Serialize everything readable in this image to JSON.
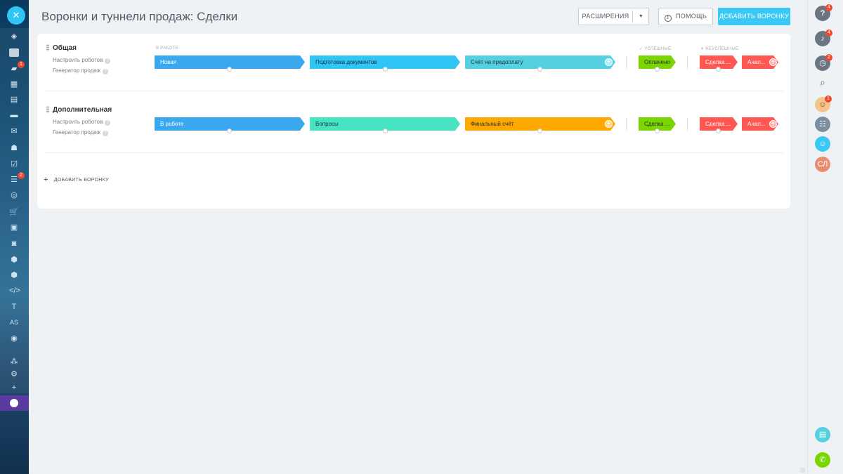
{
  "page": {
    "title": "Воронки и туннели продаж: Сделки",
    "buttons": {
      "extensions": "РАСШИРЕНИЯ",
      "help": "ПОМОЩЬ",
      "add_funnel": "ДОБАВИТЬ ВОРОНКУ"
    }
  },
  "left_sidebar": {
    "badges": {
      "messages": "1",
      "crm": "2"
    },
    "text_items": {
      "t": "T",
      "as": "AS"
    }
  },
  "right_sidebar": {
    "help_badge": "4",
    "notifications_badge": "4",
    "timeman_badge": "2",
    "avatar_badge": "1",
    "user_initials": "СЛ"
  },
  "groups": {
    "in_work": "В РАБОТЕ",
    "success": "УСПЕШНЫЕ",
    "fail": "НЕУСПЕШНЫЕ"
  },
  "funnels": [
    {
      "name": "Общая",
      "link_robots": "Настроить роботов",
      "link_generator": "Генератор продаж",
      "stages": [
        "Новая",
        "Подготовка документов",
        "Счёт на предоплату"
      ],
      "success": "Оплачено",
      "fail": [
        "Сделка ...",
        "Анал..."
      ]
    },
    {
      "name": "Дополнительная",
      "link_robots": "Настроить роботов",
      "link_generator": "Генератор продаж",
      "stages": [
        "В работе",
        "Вопросы",
        "Финальный счёт"
      ],
      "success": "Сделка ...",
      "fail": [
        "Сделка ...",
        "Анал..."
      ]
    }
  ],
  "add_funnel_link": "ДОБАВИТЬ ВОРОНКУ",
  "colors": {
    "accent": "#3bc8f5",
    "stage_blue": "#39a8ef",
    "stage_cyan": "#2fc6f6",
    "stage_teal": "#55d0e0",
    "stage_mint": "#47e4c2",
    "stage_orange": "#ffa900",
    "success_green": "#7bd500",
    "fail_red": "#ff5752"
  }
}
